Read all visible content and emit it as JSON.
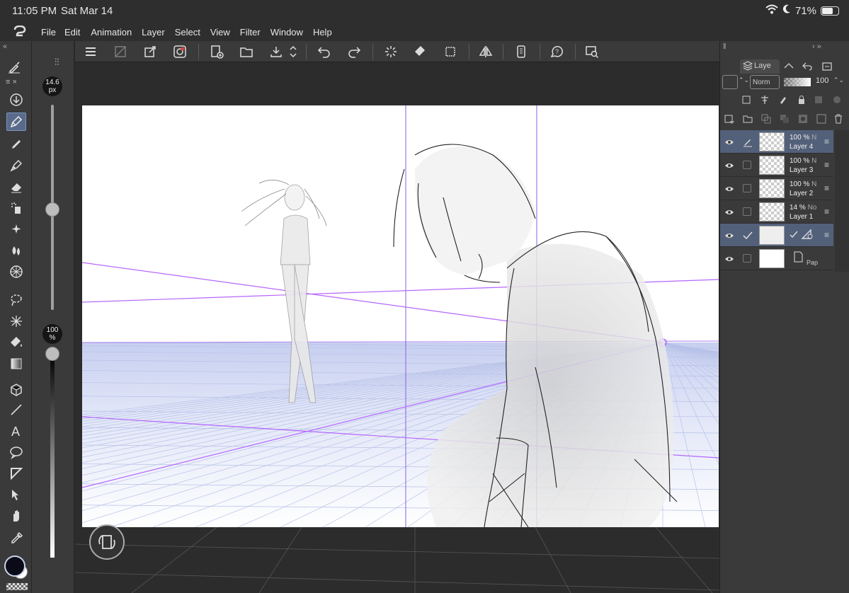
{
  "status": {
    "time": "11:05 PM",
    "date": "Sat Mar 14",
    "battery": "71%",
    "battery_level": 0.71
  },
  "menu": [
    "File",
    "Edit",
    "Animation",
    "Layer",
    "Select",
    "View",
    "Filter",
    "Window",
    "Help"
  ],
  "brush": {
    "size": "14.6",
    "size_unit": "px",
    "size_level": 0.3,
    "opacity": "100",
    "opacity_unit": "%",
    "opacity_level": 1.0
  },
  "layer_panel": {
    "tab_label": "Laye",
    "blend_mode": "Norm",
    "opacity": "100",
    "layers": [
      {
        "opacity": "100 %",
        "mode": "N",
        "name": "Layer 4",
        "selected": true,
        "editing": true
      },
      {
        "opacity": "100 %",
        "mode": "N",
        "name": "Layer 3",
        "selected": false
      },
      {
        "opacity": "100 %",
        "mode": "N",
        "name": "Layer 2",
        "selected": false
      },
      {
        "opacity": "14 %",
        "mode": "No",
        "name": "Layer 1",
        "selected": false
      },
      {
        "opacity": "",
        "mode": "",
        "name": "",
        "selected": true,
        "model": true
      },
      {
        "opacity": "",
        "mode": "",
        "name": "Pap",
        "selected": false,
        "paper": true
      }
    ]
  },
  "colors": {
    "accent": "#7b93c4",
    "perspective_line": "#b566ff",
    "grid": "#b7c2e8"
  }
}
